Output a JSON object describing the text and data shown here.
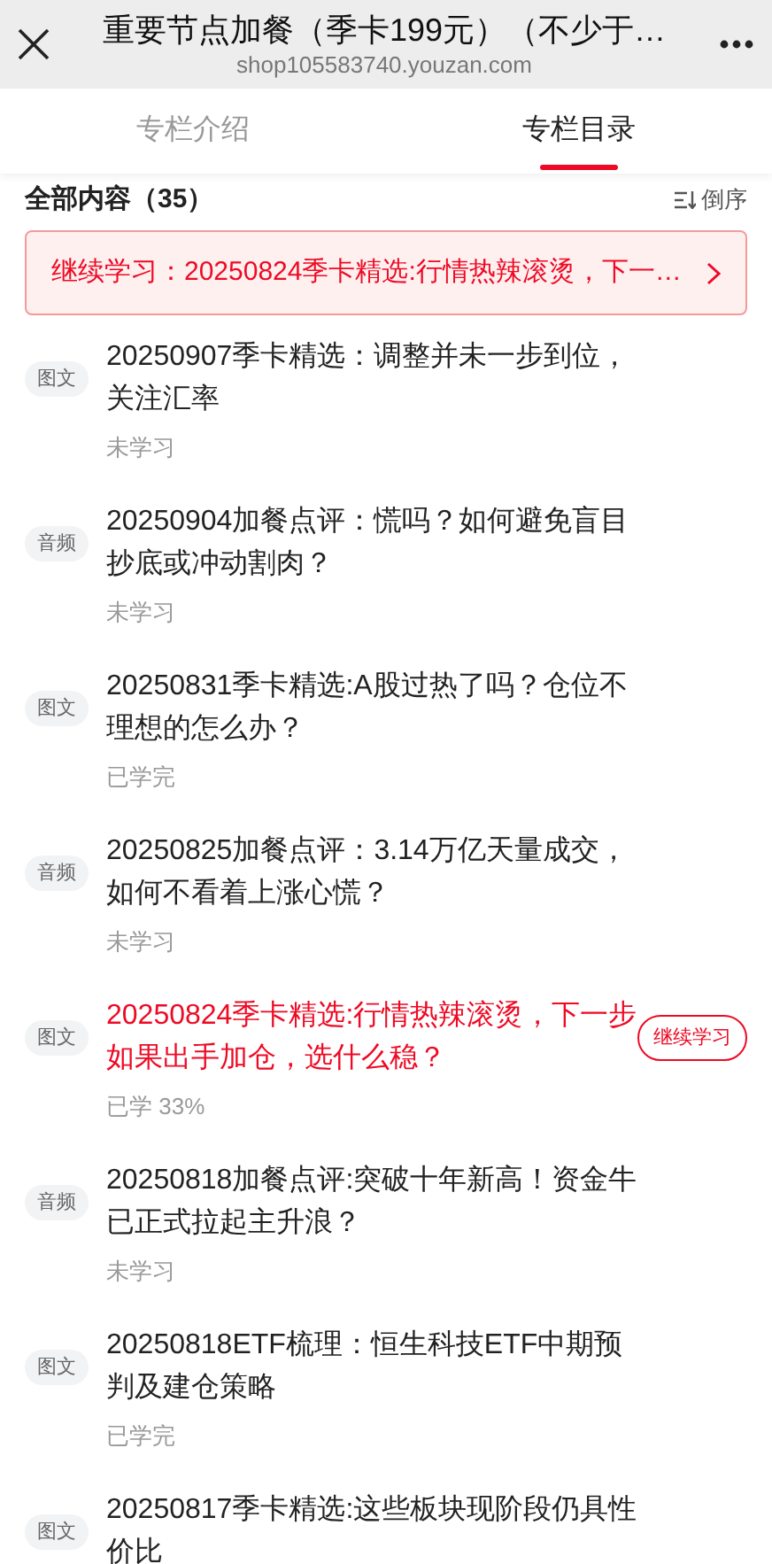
{
  "header": {
    "title": "重要节点加餐（季卡199元）（不少于…",
    "url": "shop105583740.youzan.com"
  },
  "tabs": [
    {
      "label": "专栏介绍",
      "selected": false
    },
    {
      "label": "专栏目录",
      "selected": true
    }
  ],
  "list_header": {
    "title": "全部内容（35）",
    "sort": "倒序"
  },
  "continue_banner": {
    "text": "继续学习：20250824季卡精选:行情热辣滚烫，下一…"
  },
  "items": [
    {
      "badge": "图文",
      "title": "20250907季卡精选：调整并未一步到位，关注汇率",
      "status": "未学习",
      "current": false
    },
    {
      "badge": "音频",
      "title": "20250904加餐点评：慌吗？如何避免盲目抄底或冲动割肉？",
      "status": "未学习",
      "current": false
    },
    {
      "badge": "图文",
      "title": "20250831季卡精选:A股过热了吗？仓位不理想的怎么办？",
      "status": "已学完",
      "current": false
    },
    {
      "badge": "音频",
      "title": "20250825加餐点评：3.14万亿天量成交，如何不看着上涨心慌？",
      "status": "未学习",
      "current": false
    },
    {
      "badge": "图文",
      "title": "20250824季卡精选:行情热辣滚烫，下一步如果出手加仓，选什么稳？",
      "status": "已学 33%",
      "current": true,
      "button": "继续学习"
    },
    {
      "badge": "音频",
      "title": "20250818加餐点评:突破十年新高！资金牛已正式拉起主升浪？",
      "status": "未学习",
      "current": false
    },
    {
      "badge": "图文",
      "title": "20250818ETF梳理：恒生科技ETF中期预判及建仓策略",
      "status": "已学完",
      "current": false
    },
    {
      "badge": "图文",
      "title": "20250817季卡精选:这些板块现阶段仍具性价比",
      "current": false
    }
  ]
}
